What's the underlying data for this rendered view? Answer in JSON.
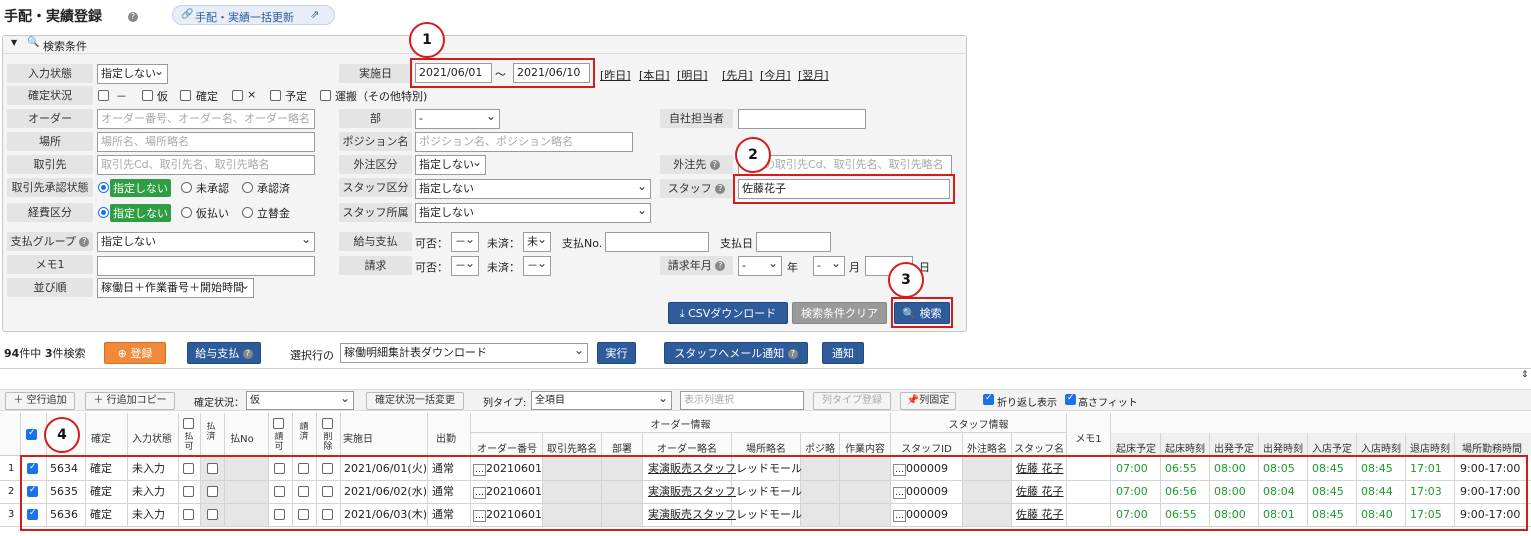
{
  "header": {
    "title": "手配・実績登録",
    "bulk_update_link": "手配・実績一括更新"
  },
  "search": {
    "panel_title": "検索条件",
    "labels": {
      "input_state": "入力状態",
      "confirm_status": "確定状況",
      "order": "オーダー",
      "place": "場所",
      "customer": "取引先",
      "customer_approval": "取引先承認状態",
      "expense": "経費区分",
      "pay_group": "支払グループ",
      "memo1": "メモ1",
      "sort": "並び順",
      "impl_date": "実施日",
      "dept": "部",
      "position": "ポジション名",
      "outsource_type": "外注区分",
      "staff_type": "スタッフ区分",
      "staff_dept": "スタッフ所属",
      "salary": "給与支払",
      "billing": "請求",
      "own_staff": "自社担当者",
      "outsource": "外注先",
      "staff": "スタッフ",
      "bill_month": "請求年月"
    },
    "input_state_value": "指定しない",
    "confirm_options": [
      "－",
      "仮",
      "確定",
      "×",
      "予定",
      "運搬（その他特別)"
    ],
    "order_placeholder": "オーダー番号、オーダー名、オーダー略名",
    "place_placeholder": "場所名、場所略名",
    "customer_placeholder": "取引先Cd、取引先名、取引先略名",
    "approval_options": [
      "指定しない",
      "未承認",
      "承認済"
    ],
    "expense_options": [
      "指定しない",
      "仮払い",
      "立替金"
    ],
    "pay_group_value": "指定しない",
    "sort_value": "稼働日＋作業番号＋開始時間",
    "date_from": "2021/06/01",
    "date_tilde": "～",
    "date_to": "2021/06/10",
    "date_links": [
      "[昨日]",
      "[本日]",
      "[明日]",
      "[先月]",
      "[今月]",
      "[翌月]"
    ],
    "dept_value": "-",
    "position_placeholder": "ポジション名、ポジション略名",
    "outsource_type_value": "指定しない",
    "staff_type_value": "指定しない",
    "staff_dept_value": "指定しない",
    "salary_allow": "可否：",
    "salary_allow_value": "－",
    "salary_unpaid": "未済：",
    "salary_unpaid_value": "未",
    "salary_no": "支払No.",
    "pay_date": "支払日",
    "billing_allow_value": "－",
    "billing_unpaid_value": "－",
    "outsource_placeholder": "外注の取引先Cd、取引先名、取引先略名",
    "staff_value": "佐藤花子",
    "year_value": "-",
    "year_unit": "年",
    "month_value": "-",
    "month_unit": "月",
    "day_unit": "日",
    "csv_button": "CSVダウンロード",
    "clear_button": "検索条件クリア",
    "search_button": "検索"
  },
  "results": {
    "count_total": "94",
    "count_mid": "件中",
    "count_found": "3",
    "count_suffix": "件検索",
    "register_button": "登録",
    "salary_button": "給与支払",
    "selected_rows_label": "選択行の",
    "action_value": "稼働明細集計表ダウンロード",
    "run_button": "実行",
    "mail_button": "スタッフへメール通知",
    "notify_button": "通知"
  },
  "toolbar": {
    "add_empty_row": "＋ 空行追加",
    "copy_row": "＋ 行追加コピー",
    "confirm_status_label": "確定状況：",
    "confirm_status_value": "仮",
    "bulk_change": "確定状況一括変更",
    "col_type_label": "列タイプ:",
    "col_type_value": "全項目",
    "display_col_select": "表示列選択",
    "col_type_register": "列タイプ登録",
    "col_fix": "列固定",
    "wrap_display": "折り返し表示",
    "height_fit": "高さフィット"
  },
  "table": {
    "group_headers": [
      "オーダー情報",
      "スタッフ情報"
    ],
    "headers": [
      "確定",
      "入力状態",
      "払可",
      "払済",
      "払No",
      "請可",
      "請済",
      "削除",
      "実施日",
      "出勤",
      "オーダー番号",
      "取引先略名",
      "部署",
      "オーダー略名",
      "場所略名",
      "ポジ略",
      "作業内容",
      "スタッフID",
      "外注略名",
      "スタッフ名",
      "メモ1",
      "起床予定",
      "起床時刻",
      "出発予定",
      "出発時刻",
      "入店予定",
      "入店時刻",
      "退店時刻",
      "場所勤務時間"
    ],
    "rows": [
      {
        "idx": "1",
        "id": "5634",
        "confirm": "確定",
        "input": "未入力",
        "date": "2021/06/01(火)",
        "attend": "通常",
        "order_no": "20210601",
        "order_name": "実演販売スタッフ",
        "place": "レッドモール",
        "staff_id": "000009",
        "staff_name": "佐藤 花子",
        "wake_plan": "07:00",
        "wake": "06:55",
        "depart_plan": "08:00",
        "depart": "08:05",
        "enter_plan": "08:45",
        "enter": "08:45",
        "exit": "17:01",
        "work_hours": "9:00-17:00"
      },
      {
        "idx": "2",
        "id": "5635",
        "confirm": "確定",
        "input": "未入力",
        "date": "2021/06/02(水)",
        "attend": "通常",
        "order_no": "20210601",
        "order_name": "実演販売スタッフ",
        "place": "レッドモール",
        "staff_id": "000009",
        "staff_name": "佐藤 花子",
        "wake_plan": "07:00",
        "wake": "06:56",
        "depart_plan": "08:00",
        "depart": "08:04",
        "enter_plan": "08:45",
        "enter": "08:44",
        "exit": "17:03",
        "work_hours": "9:00-17:00"
      },
      {
        "idx": "3",
        "id": "5636",
        "confirm": "確定",
        "input": "未入力",
        "date": "2021/06/03(木)",
        "attend": "通常",
        "order_no": "20210601",
        "order_name": "実演販売スタッフ",
        "place": "レッドモール",
        "staff_id": "000009",
        "staff_name": "佐藤 花子",
        "wake_plan": "07:00",
        "wake": "06:55",
        "depart_plan": "08:00",
        "depart": "08:01",
        "enter_plan": "08:45",
        "enter": "08:40",
        "exit": "17:05",
        "work_hours": "9:00-17:00"
      }
    ]
  },
  "callouts": [
    "1",
    "2",
    "3",
    "4"
  ],
  "colors": {
    "accent_blue": "#2e5c9a",
    "annotation_red": "#d61b1b",
    "time_green": "#1d9a2b",
    "register_orange": "#f08a3a"
  }
}
